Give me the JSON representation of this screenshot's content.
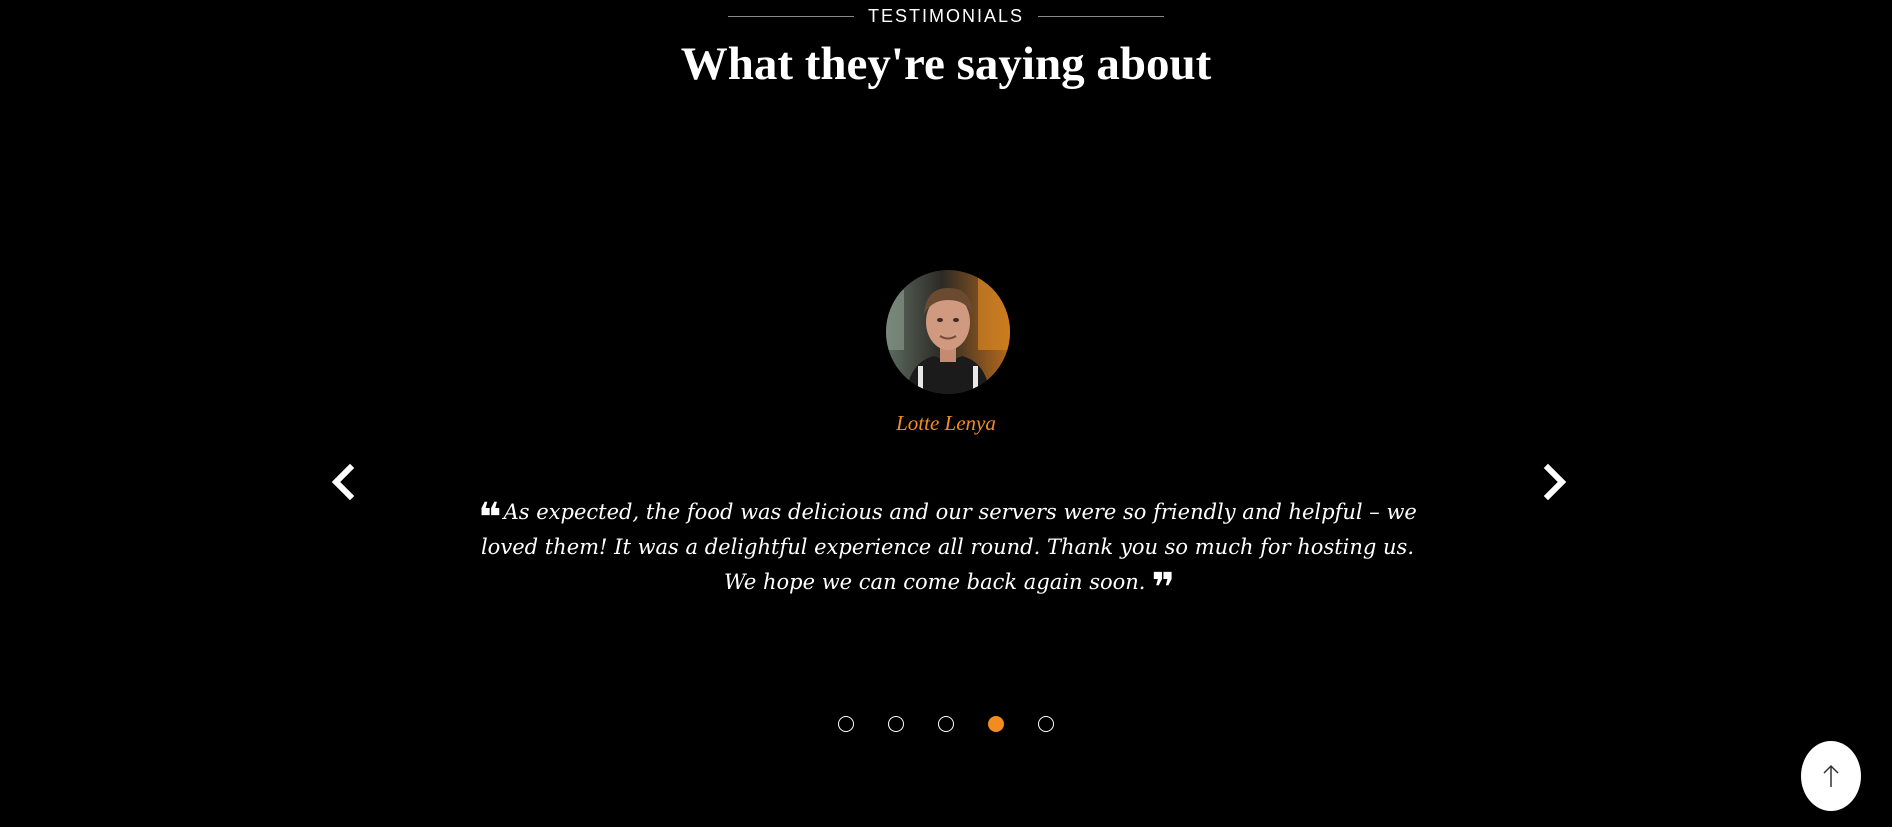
{
  "section": {
    "eyebrow": "TESTIMONIALS",
    "heading": "What they're saying about"
  },
  "testimonial": {
    "name": "Lotte Lenya",
    "text": "As expected, the food was delicious and our servers were so friendly and helpful – we loved them! It was a delightful experience all round. Thank you so much for hosting us. We hope we can come back again soon.",
    "avatar_icon": "reviewer-photo"
  },
  "carousel": {
    "prev_icon": "chevron-left-icon",
    "next_icon": "chevron-right-icon",
    "total_slides": 5,
    "active_slide": 4
  },
  "scroll_top": {
    "icon": "arrow-up-icon"
  },
  "colors": {
    "background": "#000000",
    "accent": "#f28c1e",
    "text": "#ffffff"
  }
}
